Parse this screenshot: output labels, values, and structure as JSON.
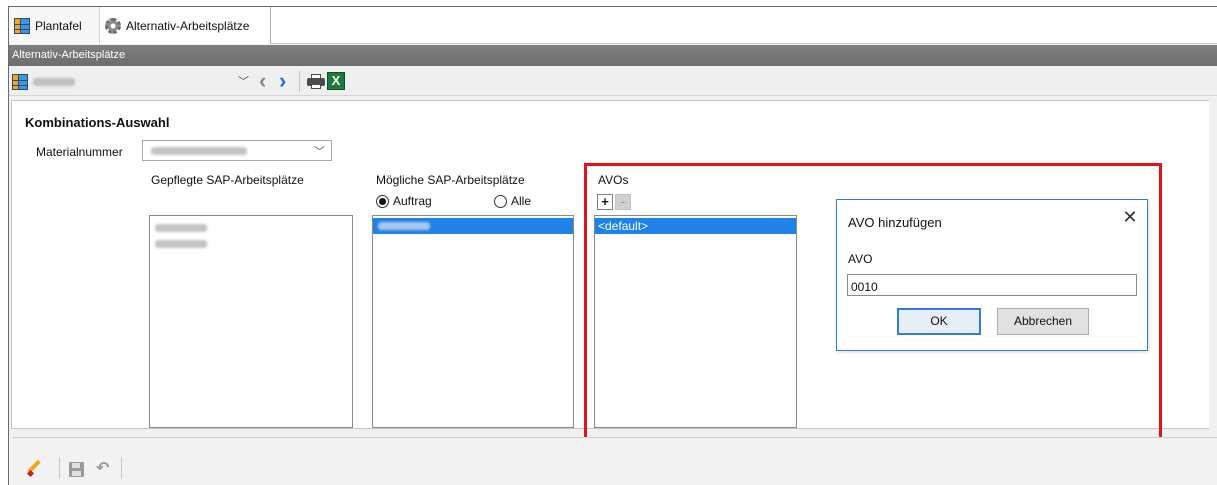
{
  "tabs": [
    {
      "label": "Plantafel",
      "icon": "plantafel-icon"
    },
    {
      "label": "Alternativ-Arbeitsplätze",
      "icon": "gear-icon"
    }
  ],
  "window_title": "Alternativ-Arbeitsplätze",
  "section_title": "Kombinations-Auswahl",
  "material": {
    "label": "Materialnummer"
  },
  "columns": {
    "gepflegte": "Gepflegte SAP-Arbeitsplätze",
    "moegliche": "Mögliche SAP-Arbeitsplätze",
    "avos": "AVOs"
  },
  "radios": {
    "auftrag": "Auftrag",
    "alle": "Alle",
    "selected": "Auftrag"
  },
  "avo_list": {
    "items": [
      "<default>"
    ],
    "add_label": "+",
    "remove_label": "-"
  },
  "dialog": {
    "title": "AVO hinzufügen",
    "field_label": "AVO",
    "field_value": "0010",
    "ok_label": "OK",
    "cancel_label": "Abbrechen",
    "close_glyph": "✕"
  },
  "colors": {
    "selection": "#1e82e6",
    "highlight_frame": "#e0141a",
    "dialog_border": "#2f7fd8",
    "title_bar": "#757575"
  }
}
